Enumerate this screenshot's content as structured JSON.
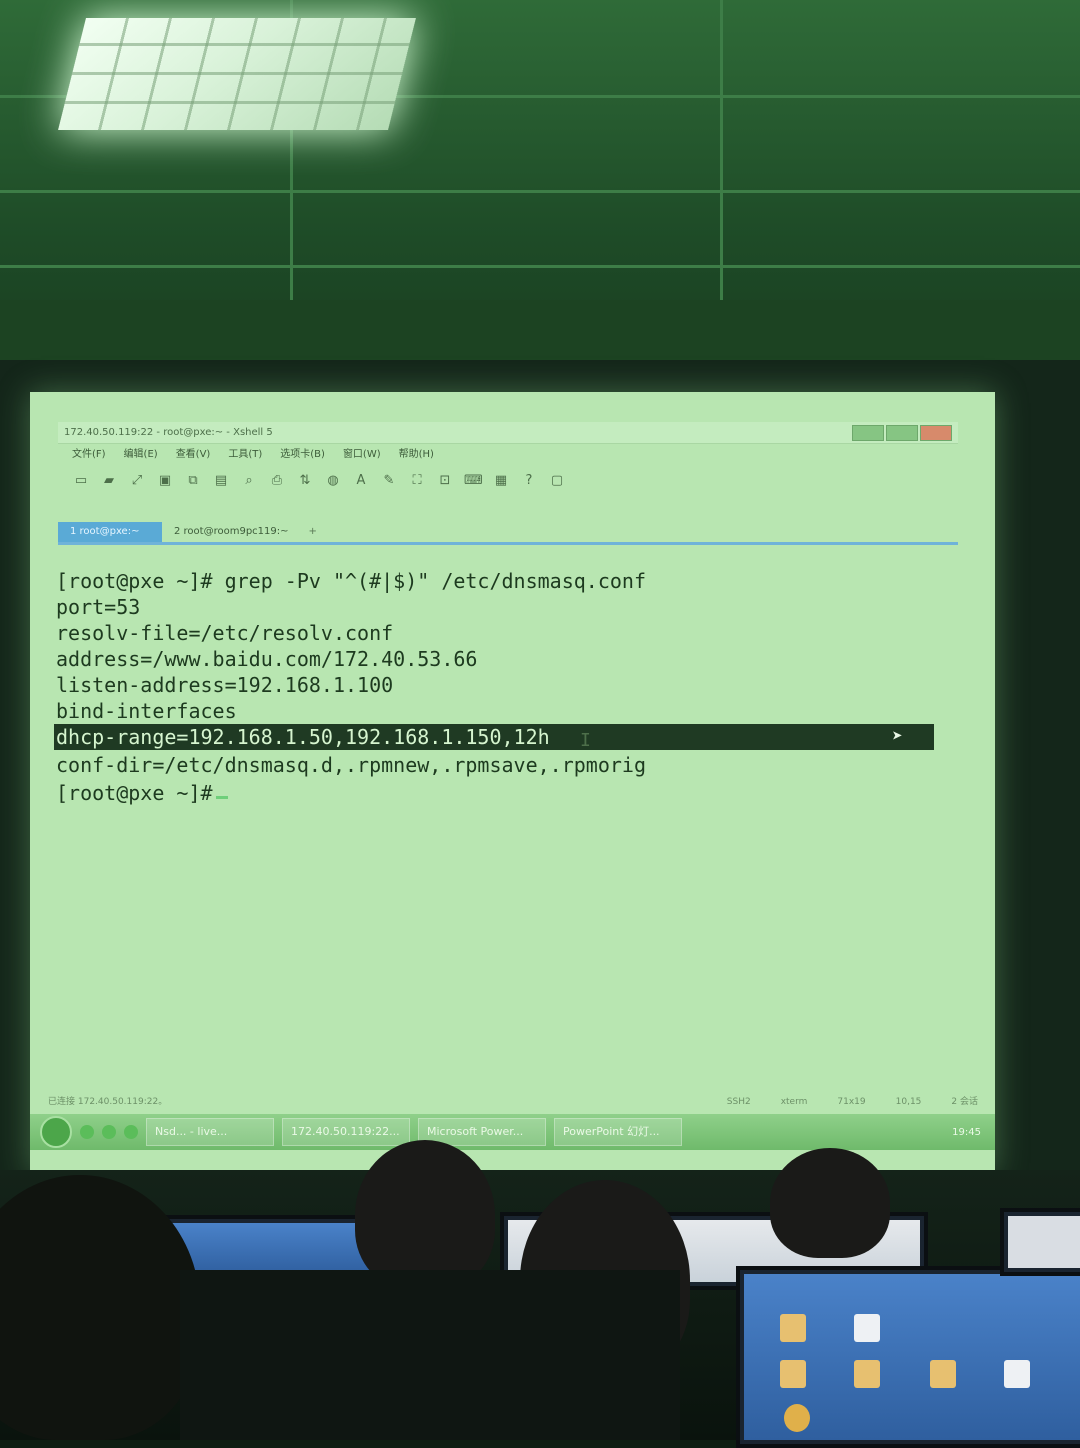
{
  "window": {
    "title": "172.40.50.119:22 - root@pxe:~ - Xshell 5"
  },
  "menu": {
    "items": [
      "文件(F)",
      "编辑(E)",
      "查看(V)",
      "工具(T)",
      "选项卡(B)",
      "窗口(W)",
      "帮助(H)"
    ]
  },
  "tabs": [
    {
      "label": "1 root@pxe:~"
    },
    {
      "label": "2 root@room9pc119:~"
    }
  ],
  "terminal": {
    "lines": [
      "[root@pxe ~]# grep -Pv \"^(#|$)\" /etc/dnsmasq.conf",
      "port=53",
      "resolv-file=/etc/resolv.conf",
      "address=/www.baidu.com/172.40.53.66",
      "listen-address=192.168.1.100",
      "bind-interfaces",
      "dhcp-range=192.168.1.50,192.168.1.150,12h",
      "conf-dir=/etc/dnsmasq.d,.rpmnew,.rpmsave,.rpmorig",
      "[root@pxe ~]#"
    ]
  },
  "status": {
    "connection": "已连接 172.40.50.119:22。",
    "protocol": "SSH2",
    "term": "xterm",
    "size": "71x19",
    "pos": "10,15",
    "sessions": "2 会话"
  },
  "taskbar": {
    "items": [
      "Nsd... - live...",
      "172.40.50.119:22...",
      "Microsoft Power...",
      "PowerPoint 幻灯..."
    ],
    "clock": "19:45"
  }
}
